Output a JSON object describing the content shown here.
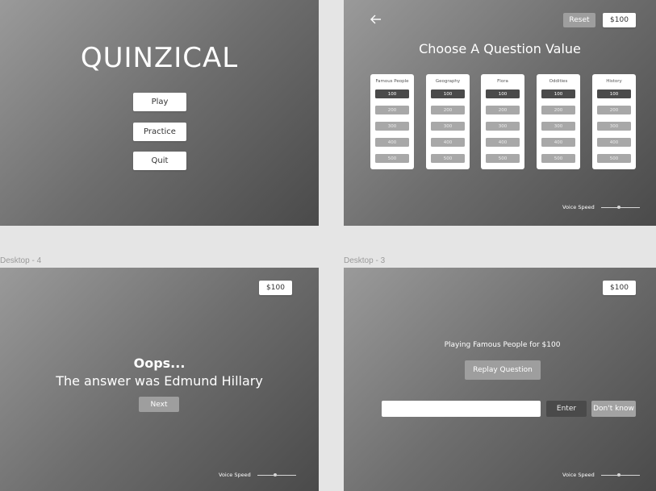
{
  "screens": {
    "start": {
      "title": "QUINZICAL",
      "play_label": "Play",
      "practice_label": "Practice",
      "quit_label": "Quit"
    },
    "choose": {
      "reset_label": "Reset",
      "money": "$100",
      "title": "Choose A Question Value",
      "categories": [
        {
          "name": "Famous People",
          "values": [
            "100",
            "200",
            "300",
            "400",
            "500"
          ]
        },
        {
          "name": "Geography",
          "values": [
            "100",
            "200",
            "300",
            "400",
            "500"
          ]
        },
        {
          "name": "Flora",
          "values": [
            "100",
            "200",
            "300",
            "400",
            "500"
          ]
        },
        {
          "name": "Oddities",
          "values": [
            "100",
            "200",
            "300",
            "400",
            "500"
          ]
        },
        {
          "name": "History",
          "values": [
            "100",
            "200",
            "300",
            "400",
            "500"
          ]
        }
      ],
      "voice_speed_label": "Voice Speed"
    },
    "result": {
      "frame_label": "Desktop - 4",
      "money": "$100",
      "heading": "Oops...",
      "message": "The answer was Edmund Hillary",
      "next_label": "Next",
      "voice_speed_label": "Voice Speed"
    },
    "question": {
      "frame_label": "Desktop - 3",
      "money": "$100",
      "playing_text": "Playing Famous People for $100",
      "replay_label": "Replay Question",
      "answer_value": "",
      "enter_label": "Enter",
      "dont_know_label": "Don't know",
      "voice_speed_label": "Voice Speed"
    }
  },
  "colors": {
    "gradient_light": "#9a9a9a",
    "gradient_dark": "#4a4a4a",
    "active_value": "#4a4a4a",
    "inactive_value": "#a8a8a8"
  }
}
